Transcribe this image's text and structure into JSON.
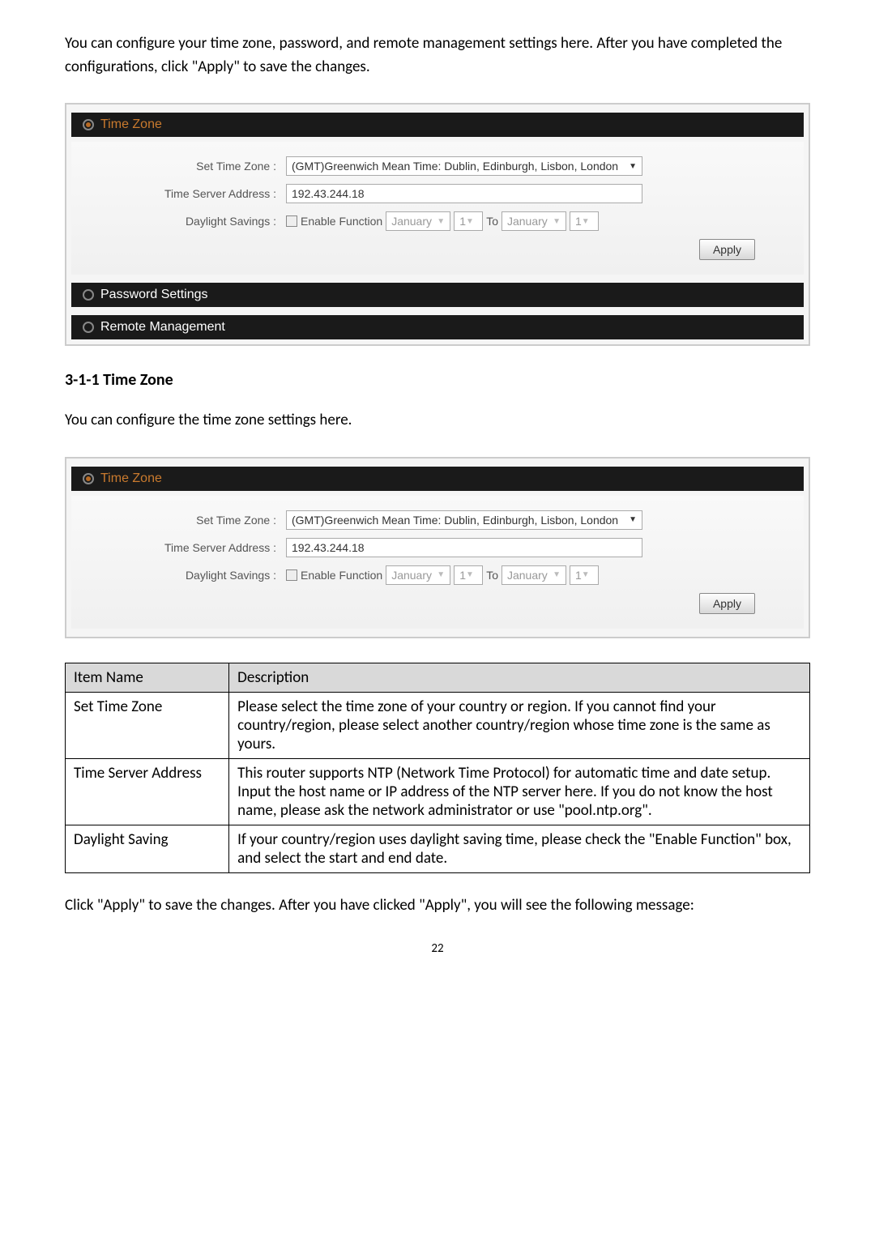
{
  "intro1": "You can configure your time zone, password, and remote management settings here. After you have completed the configurations, click \"Apply\" to save the changes.",
  "panel1": {
    "timezone_title": "Time Zone",
    "password_title": "Password Settings",
    "remote_title": "Remote Management",
    "set_time_zone_label": "Set Time Zone :",
    "set_time_zone_value": "(GMT)Greenwich Mean Time: Dublin, Edinburgh, Lisbon, London",
    "time_server_label": "Time Server Address :",
    "time_server_value": "192.43.244.18",
    "daylight_label": "Daylight Savings :",
    "daylight_enable": "Enable Function",
    "month_from": "January",
    "day_from": "1",
    "to_label": "To",
    "month_to": "January",
    "day_to": "1",
    "apply": "Apply"
  },
  "section_heading": "3-1-1 Time Zone",
  "section_intro": "You can configure the time zone settings here.",
  "table": {
    "h1": "Item Name",
    "h2": "Description",
    "r1c1": "Set Time Zone",
    "r1c2": "Please select the time zone of your country or region. If you cannot find your country/region, please select another country/region whose time zone is the same as yours.",
    "r2c1": "Time Server Address",
    "r2c2": "This router supports NTP (Network Time Protocol) for automatic time and date setup. Input the host name or IP address of the NTP server here. If you do not know the host name, please ask the network administrator or use \"pool.ntp.org\".",
    "r3c1": "Daylight Saving",
    "r3c2": "If your country/region uses daylight saving time, please check the \"Enable Function\" box, and select the start and end date."
  },
  "outro": "Click \"Apply\" to save the changes. After you have clicked \"Apply\", you will see the following message:",
  "page_number": "22"
}
